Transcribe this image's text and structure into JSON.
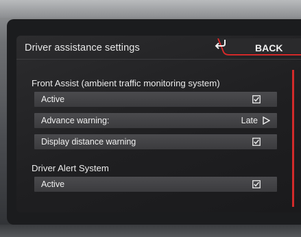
{
  "header": {
    "title": "Driver assistance settings",
    "back_label": "BACK",
    "back_icon": "return-arrow-icon",
    "accent_color": "#d32a2a"
  },
  "sections": [
    {
      "title": "Front Assist (ambient traffic monitoring system)",
      "rows": [
        {
          "label": "Active",
          "control": "checkbox",
          "checked": true
        },
        {
          "label": "Advance warning:",
          "control": "value",
          "value": "Late"
        },
        {
          "label": "Display distance warning",
          "control": "checkbox",
          "checked": true
        }
      ]
    },
    {
      "title": "Driver Alert System",
      "rows": [
        {
          "label": "Active",
          "control": "checkbox",
          "checked": true
        }
      ]
    }
  ]
}
